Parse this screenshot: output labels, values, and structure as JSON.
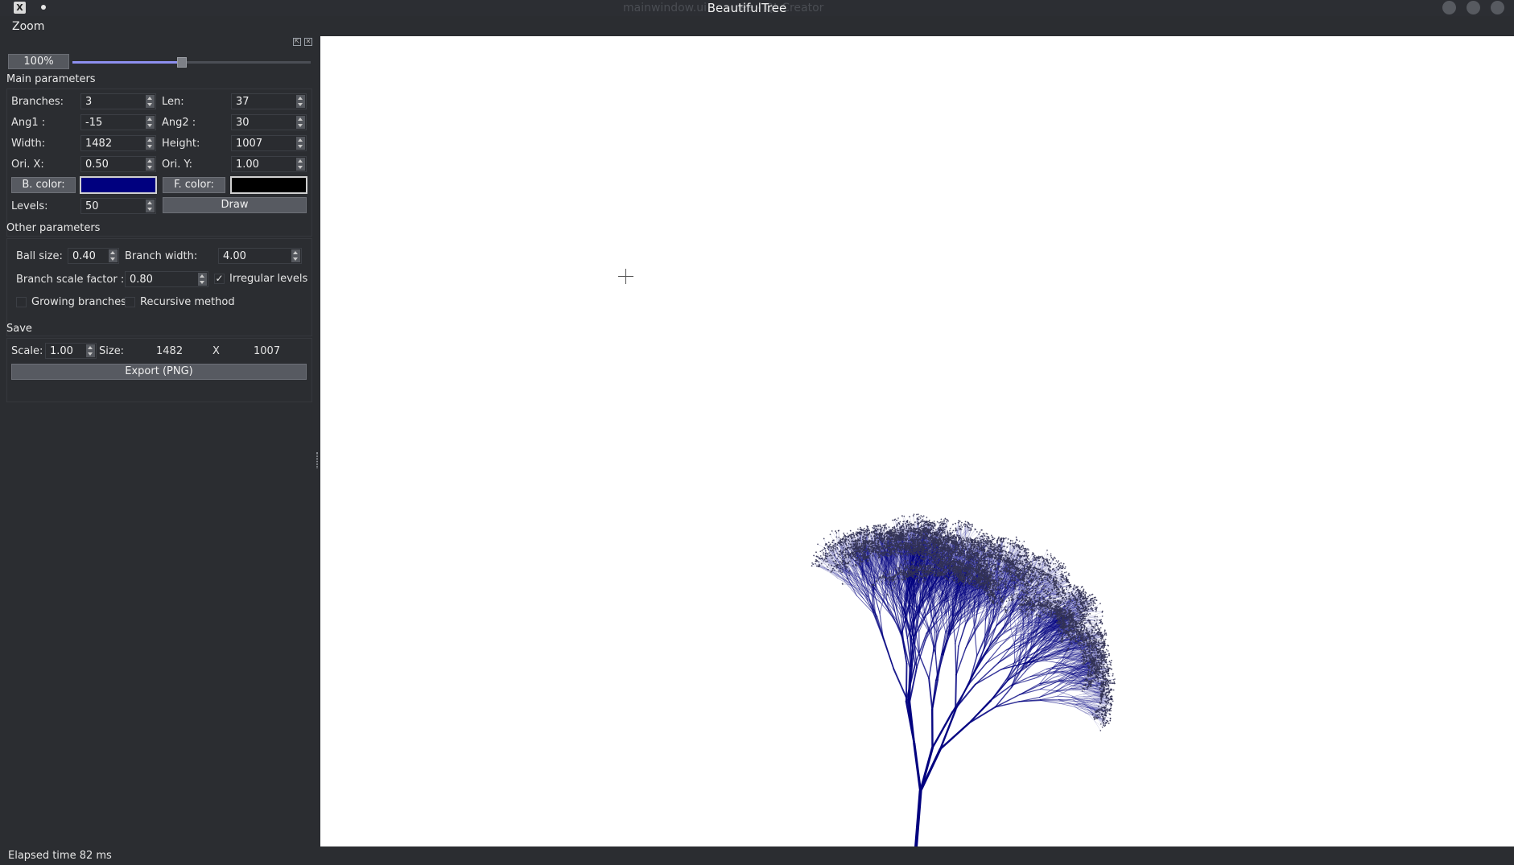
{
  "window": {
    "ghost_title": "mainwindow.ui        ree - Qt Creator",
    "title": "BeautifulTree",
    "app_icon": "X"
  },
  "zoom": {
    "panel_title": "Zoom",
    "value": "100%",
    "slider_level": 0.5
  },
  "main_parameters": {
    "section_label": "Main parameters",
    "branches_label": "Branches:",
    "branches": "3",
    "len_label": "Len:",
    "len": "37",
    "ang1_label": "Ang1 :",
    "ang1": "-15",
    "ang2_label": "Ang2 :",
    "ang2": "30",
    "width_label": "Width:",
    "width": "1482",
    "height_label": "Height:",
    "height": "1007",
    "orix_label": "Ori. X:",
    "orix": "0.50",
    "oriy_label": "Ori. Y:",
    "oriy": "1.00",
    "b_color_label": "B. color:",
    "b_color": "#00007f",
    "f_color_label": "F. color:",
    "f_color": "#000000",
    "levels_label": "Levels:",
    "levels": "50",
    "draw_label": "Draw"
  },
  "other_parameters": {
    "section_label": "Other parameters",
    "ball_size_label": "Ball size:",
    "ball_size": "0.40",
    "branch_width_label": "Branch width:",
    "branch_width": "4.00",
    "branch_scale_label": "Branch scale factor :",
    "branch_scale": "0.80",
    "irregular_levels_label": "Irregular levels",
    "irregular_levels_checked": "✓",
    "growing_branches_label": "Growing branches",
    "recursive_method_label": "Recursive method"
  },
  "save": {
    "section_label": "Save",
    "scale_label": "Scale:",
    "scale": "1.00",
    "size_label": "Size:",
    "size_w": "1482",
    "size_x": "X",
    "size_h": "1007",
    "export_label": "Export (PNG)"
  },
  "status": {
    "text": "Elapsed time 82 ms"
  }
}
